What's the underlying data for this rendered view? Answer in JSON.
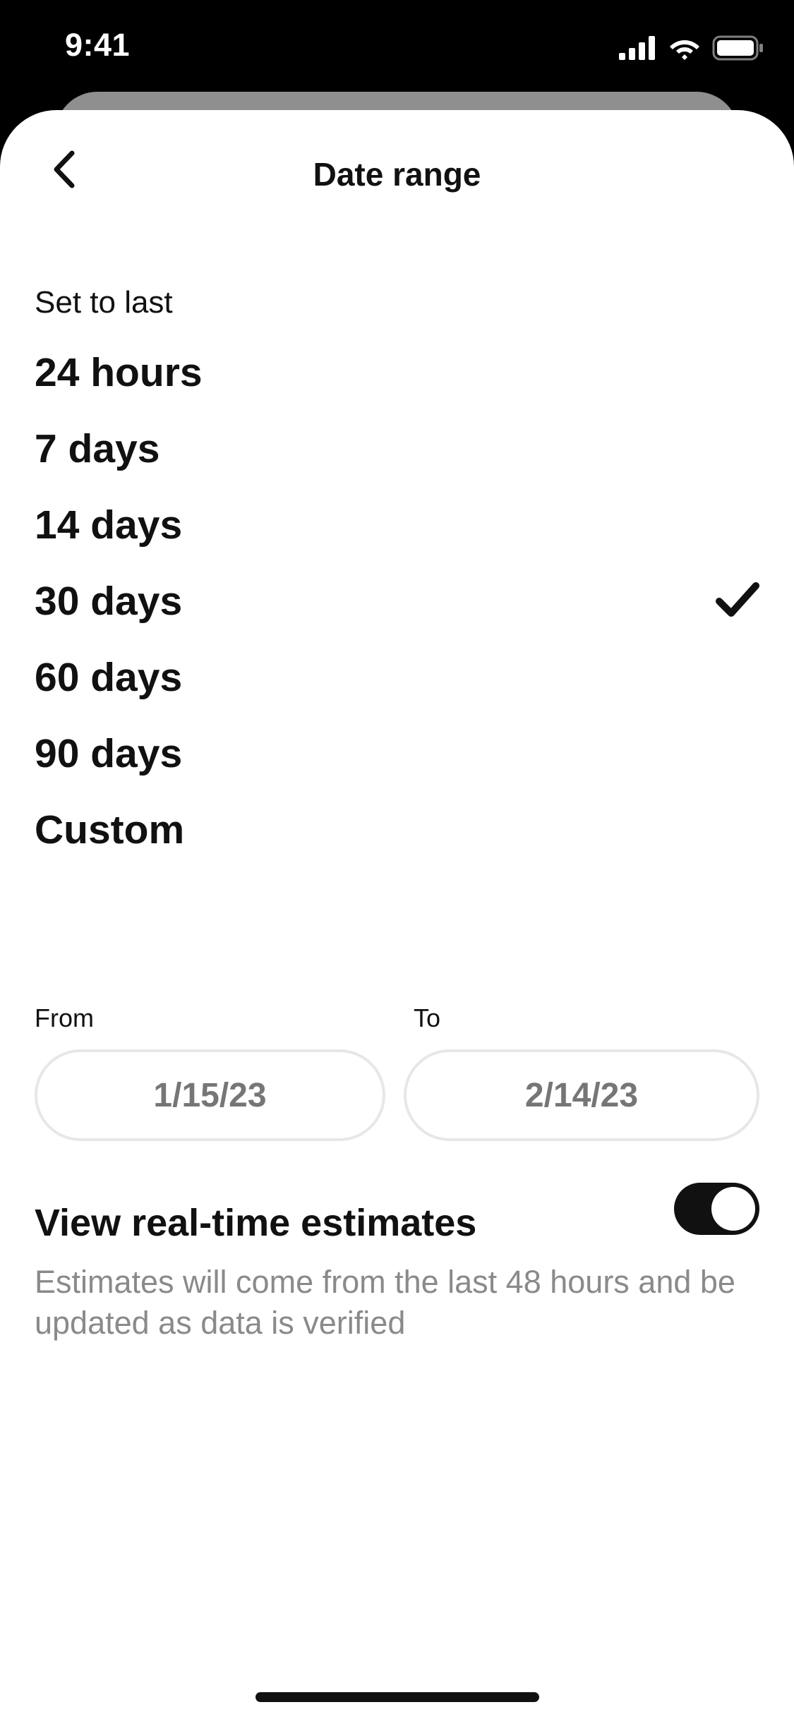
{
  "status_bar": {
    "time": "9:41",
    "icons": [
      "signal-icon",
      "wifi-icon",
      "battery-icon"
    ]
  },
  "header": {
    "title": "Date range",
    "back_icon": "chevron-left-icon"
  },
  "section_label": "Set to last",
  "options": [
    {
      "label": "24 hours",
      "selected": false
    },
    {
      "label": "7 days",
      "selected": false
    },
    {
      "label": "14 days",
      "selected": false
    },
    {
      "label": "30 days",
      "selected": true
    },
    {
      "label": "60 days",
      "selected": false
    },
    {
      "label": "90 days",
      "selected": false
    },
    {
      "label": "Custom",
      "selected": false
    }
  ],
  "custom_range": {
    "from_label": "From",
    "to_label": "To",
    "from_value": "1/15/23",
    "to_value": "2/14/23"
  },
  "estimates": {
    "title": "View real-time estimates",
    "enabled": true,
    "description": "Estimates will come from the last 48 hours and be updated as data is verified"
  },
  "colors": {
    "text_primary": "#111111",
    "text_secondary": "#8a8a8a",
    "toggle_on": "#111111",
    "field_border": "#e7e7e7"
  }
}
